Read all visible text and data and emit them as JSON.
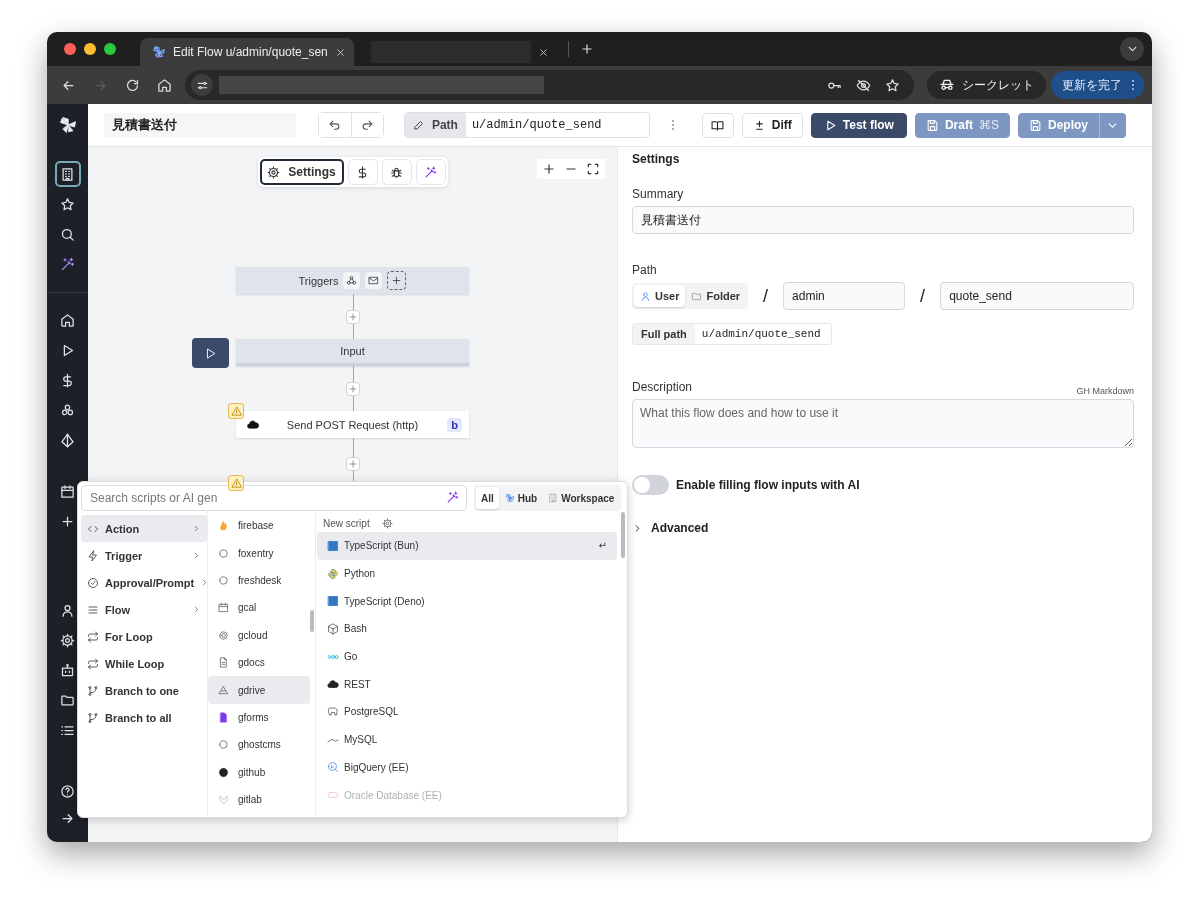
{
  "browser": {
    "tabs": [
      {
        "title": "Edit Flow u/admin/quote_sen",
        "selected": true
      },
      {
        "selected": false
      }
    ],
    "incognito_label": "シークレット",
    "update_button": "更新を完了"
  },
  "header": {
    "title": "見積書送付",
    "path_label": "Path",
    "path_value": "u/admin/quote_send",
    "diff_button": "Diff",
    "test_button": "Test flow",
    "draft_button": "Draft",
    "draft_shortcut": "⌘S",
    "deploy_button": "Deploy"
  },
  "sidebar": {
    "items": [
      {
        "selected": true
      },
      {
        "selected": false
      },
      {
        "selected": false
      },
      {
        "selected": false
      },
      {
        "selected": false
      },
      {
        "selected": false
      },
      {
        "selected": false
      },
      {
        "selected": false
      },
      {
        "selected": false
      },
      {
        "selected": false
      },
      {
        "selected": false
      },
      {
        "selected": false
      },
      {
        "selected": false
      },
      {
        "selected": false
      },
      {
        "selected": false
      },
      {
        "selected": false
      },
      {
        "selected": false
      },
      {
        "selected": false
      }
    ]
  },
  "canvas": {
    "tabs": [
      {
        "label": "Settings",
        "selected": true
      },
      {
        "selected": false
      },
      {
        "selected": false
      },
      {
        "selected": false
      }
    ],
    "nodes": [
      {
        "kind": "triggers",
        "label": "Triggers"
      },
      {
        "kind": "input",
        "label": "Input"
      },
      {
        "kind": "step",
        "label": "Send POST Request (http)",
        "badge": "b",
        "warning": true
      }
    ]
  },
  "picker": {
    "search_placeholder": "Search scripts or AI gen",
    "filters": [
      {
        "label": "All",
        "selected": true
      },
      {
        "label": "Hub",
        "selected": false
      },
      {
        "label": "Workspace",
        "selected": false
      }
    ],
    "categories": [
      {
        "label": "Action",
        "selected": true,
        "submenu": true
      },
      {
        "label": "Trigger",
        "selected": false,
        "submenu": true
      },
      {
        "label": "Approval/Prompt",
        "selected": false,
        "submenu": true
      },
      {
        "label": "Flow",
        "selected": false,
        "submenu": true
      },
      {
        "label": "For Loop",
        "selected": false,
        "submenu": false
      },
      {
        "label": "While Loop",
        "selected": false,
        "submenu": false
      },
      {
        "label": "Branch to one",
        "selected": false,
        "submenu": false
      },
      {
        "label": "Branch to all",
        "selected": false,
        "submenu": false
      }
    ],
    "integrations": [
      {
        "label": "firebase",
        "selected": false,
        "dimmed": false
      },
      {
        "label": "foxentry",
        "selected": false,
        "dimmed": false
      },
      {
        "label": "freshdesk",
        "selected": false,
        "dimmed": false
      },
      {
        "label": "gcal",
        "selected": false,
        "dimmed": false
      },
      {
        "label": "gcloud",
        "selected": false,
        "dimmed": false
      },
      {
        "label": "gdocs",
        "selected": false,
        "dimmed": false
      },
      {
        "label": "gdrive",
        "selected": true,
        "dimmed": false
      },
      {
        "label": "gforms",
        "selected": false,
        "dimmed": false
      },
      {
        "label": "ghostcms",
        "selected": false,
        "dimmed": false
      },
      {
        "label": "github",
        "selected": false,
        "dimmed": false
      },
      {
        "label": "gitlab",
        "selected": false,
        "dimmed": true
      }
    ],
    "new_script_label": "New script",
    "enter_hint": "↵",
    "languages": [
      {
        "label": "TypeScript (Bun)",
        "selected": true,
        "dimmed": false
      },
      {
        "label": "Python",
        "selected": false,
        "dimmed": false
      },
      {
        "label": "TypeScript (Deno)",
        "selected": false,
        "dimmed": false
      },
      {
        "label": "Bash",
        "selected": false,
        "dimmed": false
      },
      {
        "label": "Go",
        "selected": false,
        "dimmed": false
      },
      {
        "label": "REST",
        "selected": false,
        "dimmed": false
      },
      {
        "label": "PostgreSQL",
        "selected": false,
        "dimmed": false
      },
      {
        "label": "MySQL",
        "selected": false,
        "dimmed": false
      },
      {
        "label": "BigQuery (EE)",
        "selected": false,
        "dimmed": false
      },
      {
        "label": "Oracle Database (EE)",
        "selected": false,
        "dimmed": true
      }
    ]
  },
  "settings": {
    "title": "Settings",
    "summary_label": "Summary",
    "summary_value": "見積書送付",
    "path_label": "Path",
    "owner_options": [
      {
        "label": "User",
        "selected": true
      },
      {
        "label": "Folder",
        "selected": false
      }
    ],
    "owner_separator": "/",
    "owner_value": "admin",
    "name_separator": "/",
    "name_value": "quote_send",
    "full_path_label": "Full path",
    "full_path_value": "u/admin/quote_send",
    "description_label": "Description",
    "description_hint": "GH Markdown",
    "description_placeholder": "What this flow does and how to use it",
    "ai_toggle": {
      "label": "Enable filling flow inputs with AI",
      "on": false
    },
    "advanced": {
      "label": "Advanced",
      "expanded": false
    }
  }
}
